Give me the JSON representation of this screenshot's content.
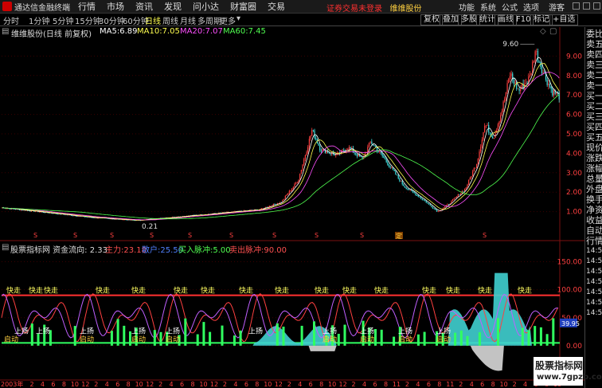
{
  "menubar": {
    "title": "通达信金融终端",
    "menu": [
      "行情",
      "市场",
      "资讯",
      "发现",
      "问小达",
      "财富圈",
      "交易"
    ],
    "notice": "证券交易未登录",
    "stock_link": "维维股份",
    "right": [
      "功能",
      "系统",
      "公式",
      "选项"
    ],
    "login": "游客"
  },
  "toolbar": {
    "periods": [
      "分时",
      "1分钟",
      "5分钟",
      "15分钟",
      "30分钟",
      "60分钟",
      "日线",
      "周线",
      "月线",
      "多周期",
      "更多"
    ],
    "active": "日线",
    "right_buttons": [
      "复权",
      "叠加",
      "多股",
      "统计",
      "画线",
      "F10",
      "标记",
      "+自选"
    ]
  },
  "main_chart": {
    "stock_label": "维维股份(日线 前复权)",
    "ma": [
      {
        "label": "MA5:",
        "value": "6.89",
        "color": "#ffffff"
      },
      {
        "label": "MA10:",
        "value": "7.05",
        "color": "#ffff50"
      },
      {
        "label": "MA20:",
        "value": "7.07",
        "color": "#ff50ff"
      },
      {
        "label": "MA60:",
        "value": "7.45",
        "color": "#50ff50"
      }
    ],
    "y_ticks": [
      "9.00",
      "8.00",
      "7.00",
      "6.00",
      "5.00",
      "4.00",
      "3.00",
      "2.00",
      "1.00"
    ],
    "high_label": "9.60",
    "low_label": "0.21",
    "marker_s": "S",
    "marker_ding": "定"
  },
  "sub_chart": {
    "title": "股票指标网 资金流向: 2.33",
    "main_force": {
      "label": "主力:",
      "value": "23.18",
      "color": "#ff5050"
    },
    "retail": {
      "label": "散户:",
      "value": "25.50",
      "color": "#5080ff"
    },
    "buy_line": {
      "label": "买入脉冲:",
      "value": "5.00",
      "color": "#50ff50"
    },
    "sell_line": {
      "label": "卖出脉冲:",
      "value": "90.00",
      "color": "#ff5050"
    },
    "y_ticks": [
      "150.00",
      "100.00",
      "50.00",
      "0.00"
    ],
    "current_value": "39.95",
    "sig_fast": "快走",
    "sig_up": "上扬",
    "sig_start": "启动"
  },
  "x_axis": {
    "year": "2003年",
    "labels": [
      "2",
      "4",
      "6",
      "8",
      "10",
      "12",
      "2",
      "4",
      "6",
      "8",
      "10",
      "12",
      "2",
      "4",
      "6",
      "8",
      "10",
      "12",
      "2",
      "4",
      "6",
      "8",
      "10",
      "12",
      "2",
      "4",
      "6",
      "8",
      "10",
      "12",
      "2",
      "4",
      "6",
      "8",
      "11",
      "2",
      "4",
      "6",
      "8",
      "11",
      "2",
      "4",
      "6",
      "8",
      "10",
      "2",
      "4",
      "6",
      "8",
      "10"
    ]
  },
  "sidebar": {
    "items": [
      "委比",
      "卖五",
      "卖四",
      "卖三",
      "卖二",
      "卖一",
      "买一",
      "买二",
      "买三",
      "买四",
      "买五",
      "现价",
      "涨跌",
      "涨幅",
      "总量",
      "外盘",
      "换手",
      "净资",
      "收益",
      "自动",
      "行情",
      "14:50",
      "14:50",
      "14:50",
      "14:50",
      "14:50",
      "14:50",
      "14:50"
    ]
  },
  "watermark": {
    "line1": "股票指标网",
    "line2": "www.7gpzb.com"
  }
}
